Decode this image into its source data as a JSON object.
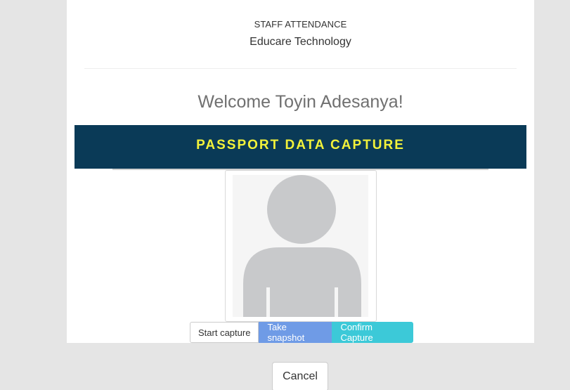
{
  "header": {
    "subtitle": "STAFF ATTENDANCE",
    "organization": "Educare Technology"
  },
  "welcome": {
    "text": "Welcome Toyin Adesanya!"
  },
  "banner": {
    "title": "PASSPORT DATA CAPTURE",
    "background": "#0a3a57",
    "text_color": "#f2f23a"
  },
  "photo": {
    "icon": "user-silhouette-icon"
  },
  "capture": {
    "start_label": "Start capture",
    "snapshot_label": "Take snapshot",
    "confirm_label": "Confirm Capture"
  },
  "footer": {
    "cancel_label": "Cancel"
  }
}
